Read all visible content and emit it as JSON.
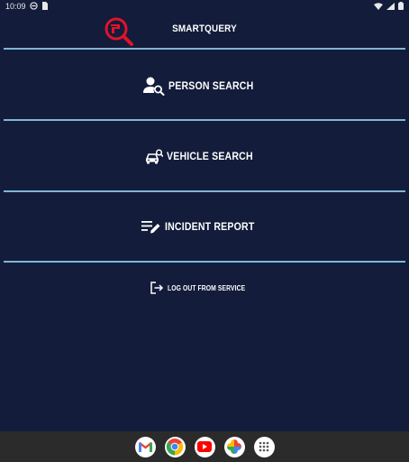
{
  "status_bar": {
    "time": "10:09",
    "left_icons": [
      "media-icon",
      "sim-icon"
    ],
    "right_icons": [
      "wifi-icon",
      "signal-icon",
      "battery-icon"
    ]
  },
  "header": {
    "title": "SMARTQUERY",
    "logo_color": "#e0132b"
  },
  "menu": {
    "person_search": "PERSON SEARCH",
    "vehicle_search": "VEHICLE SEARCH",
    "incident_report": "INCIDENT REPORT",
    "logout": "LOG OUT FROM SERVICE"
  },
  "colors": {
    "background": "#131c3a",
    "divider": "#7fb6d6",
    "dock": "#2b2b2b"
  },
  "dock": {
    "apps": [
      "gmail-icon",
      "chrome-icon",
      "youtube-icon",
      "photos-icon",
      "app-drawer-icon"
    ]
  }
}
